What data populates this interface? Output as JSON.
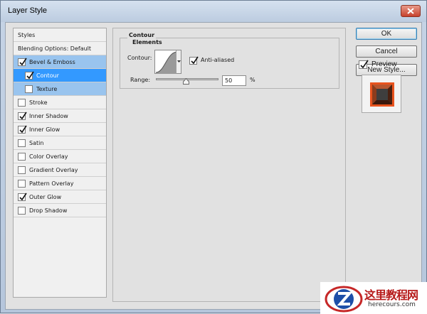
{
  "window": {
    "title": "Layer Style"
  },
  "style_list": {
    "header": "Styles",
    "blending": "Blending Options: Default",
    "items": [
      {
        "label": "Bevel & Emboss",
        "checked": true
      },
      {
        "label": "Contour",
        "checked": true
      },
      {
        "label": "Texture",
        "checked": false
      },
      {
        "label": "Stroke",
        "checked": false
      },
      {
        "label": "Inner Shadow",
        "checked": true
      },
      {
        "label": "Inner Glow",
        "checked": true
      },
      {
        "label": "Satin",
        "checked": false
      },
      {
        "label": "Color Overlay",
        "checked": false
      },
      {
        "label": "Gradient Overlay",
        "checked": false
      },
      {
        "label": "Pattern Overlay",
        "checked": false
      },
      {
        "label": "Outer Glow",
        "checked": true
      },
      {
        "label": "Drop Shadow",
        "checked": false
      }
    ]
  },
  "contour_panel": {
    "title": "Contour",
    "subtitle": "Elements",
    "contour_label": "Contour:",
    "anti_aliased_label": "Anti-aliased",
    "anti_aliased_checked": true,
    "range_label": "Range:",
    "range_value": "50",
    "range_unit": "%",
    "range_fraction": 0.5
  },
  "buttons": {
    "ok": "OK",
    "cancel": "Cancel",
    "new_style": "New Style..."
  },
  "preview": {
    "label": "Preview",
    "checked": true
  },
  "watermark": {
    "cn": "这里教程网",
    "en": "herecours.com"
  },
  "colors": {
    "selection_dark": "#3399ff",
    "selection_light": "#99c4ee",
    "preview_orange": "#e8531e"
  }
}
